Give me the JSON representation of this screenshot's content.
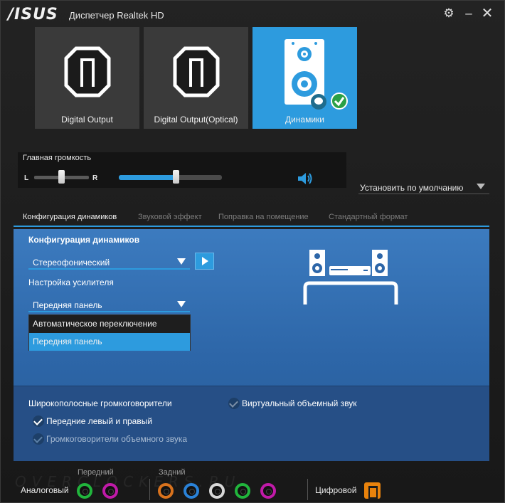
{
  "titlebar": {
    "logo": "/ISUS",
    "title": "Диспетчер Realtek HD",
    "gear_icon": "gear-icon",
    "minimize_icon": "minimize-icon",
    "close_icon": "close-icon"
  },
  "devices": [
    {
      "label": "Digital Output",
      "icon": "digital-output-icon",
      "active": false
    },
    {
      "label": "Digital Output(Optical)",
      "icon": "digital-optical-icon",
      "active": false
    },
    {
      "label": "Динамики",
      "icon": "speakers-icon",
      "active": true
    }
  ],
  "volume": {
    "title": "Главная громкость",
    "left_label": "L",
    "right_label": "R",
    "balance": 0.5,
    "level": 0.55
  },
  "default_dropdown": {
    "label": "Установить по умолчанию"
  },
  "tabs": [
    {
      "label": "Конфигурация динамиков",
      "active": true
    },
    {
      "label": "Звуковой эффект",
      "active": false
    },
    {
      "label": "Поправка на помещение",
      "active": false
    },
    {
      "label": "Стандартный формат",
      "active": false
    }
  ],
  "speaker_config": {
    "section_title": "Конфигурация динамиков",
    "config_value": "Стереофонический",
    "amp_label": "Настройка усилителя",
    "amp_value": "Передняя панель",
    "amp_options": [
      {
        "label": "Автоматическое переключение",
        "selected": false
      },
      {
        "label": "Передняя панель",
        "selected": true
      }
    ]
  },
  "options": {
    "wideband": "Широкополосные громкоговорители",
    "front_lr": "Передние левый и правый",
    "surround_speakers": "Громкоговорители объемного звука",
    "virtual_surround": "Виртуальный объемный звук"
  },
  "jacks": {
    "front_label": "Передний",
    "rear_label": "Задний",
    "analog_label": "Аналоговый",
    "digital_label": "Цифровой",
    "front": [
      "#21b53c",
      "#c01aa8"
    ],
    "rear": [
      "#d8721d",
      "#2a82d8",
      "#1a1a1a",
      "#21b53c",
      "#c01aa8"
    ]
  },
  "colors": {
    "accent": "#2d9bde",
    "orange": "#e8820c"
  }
}
